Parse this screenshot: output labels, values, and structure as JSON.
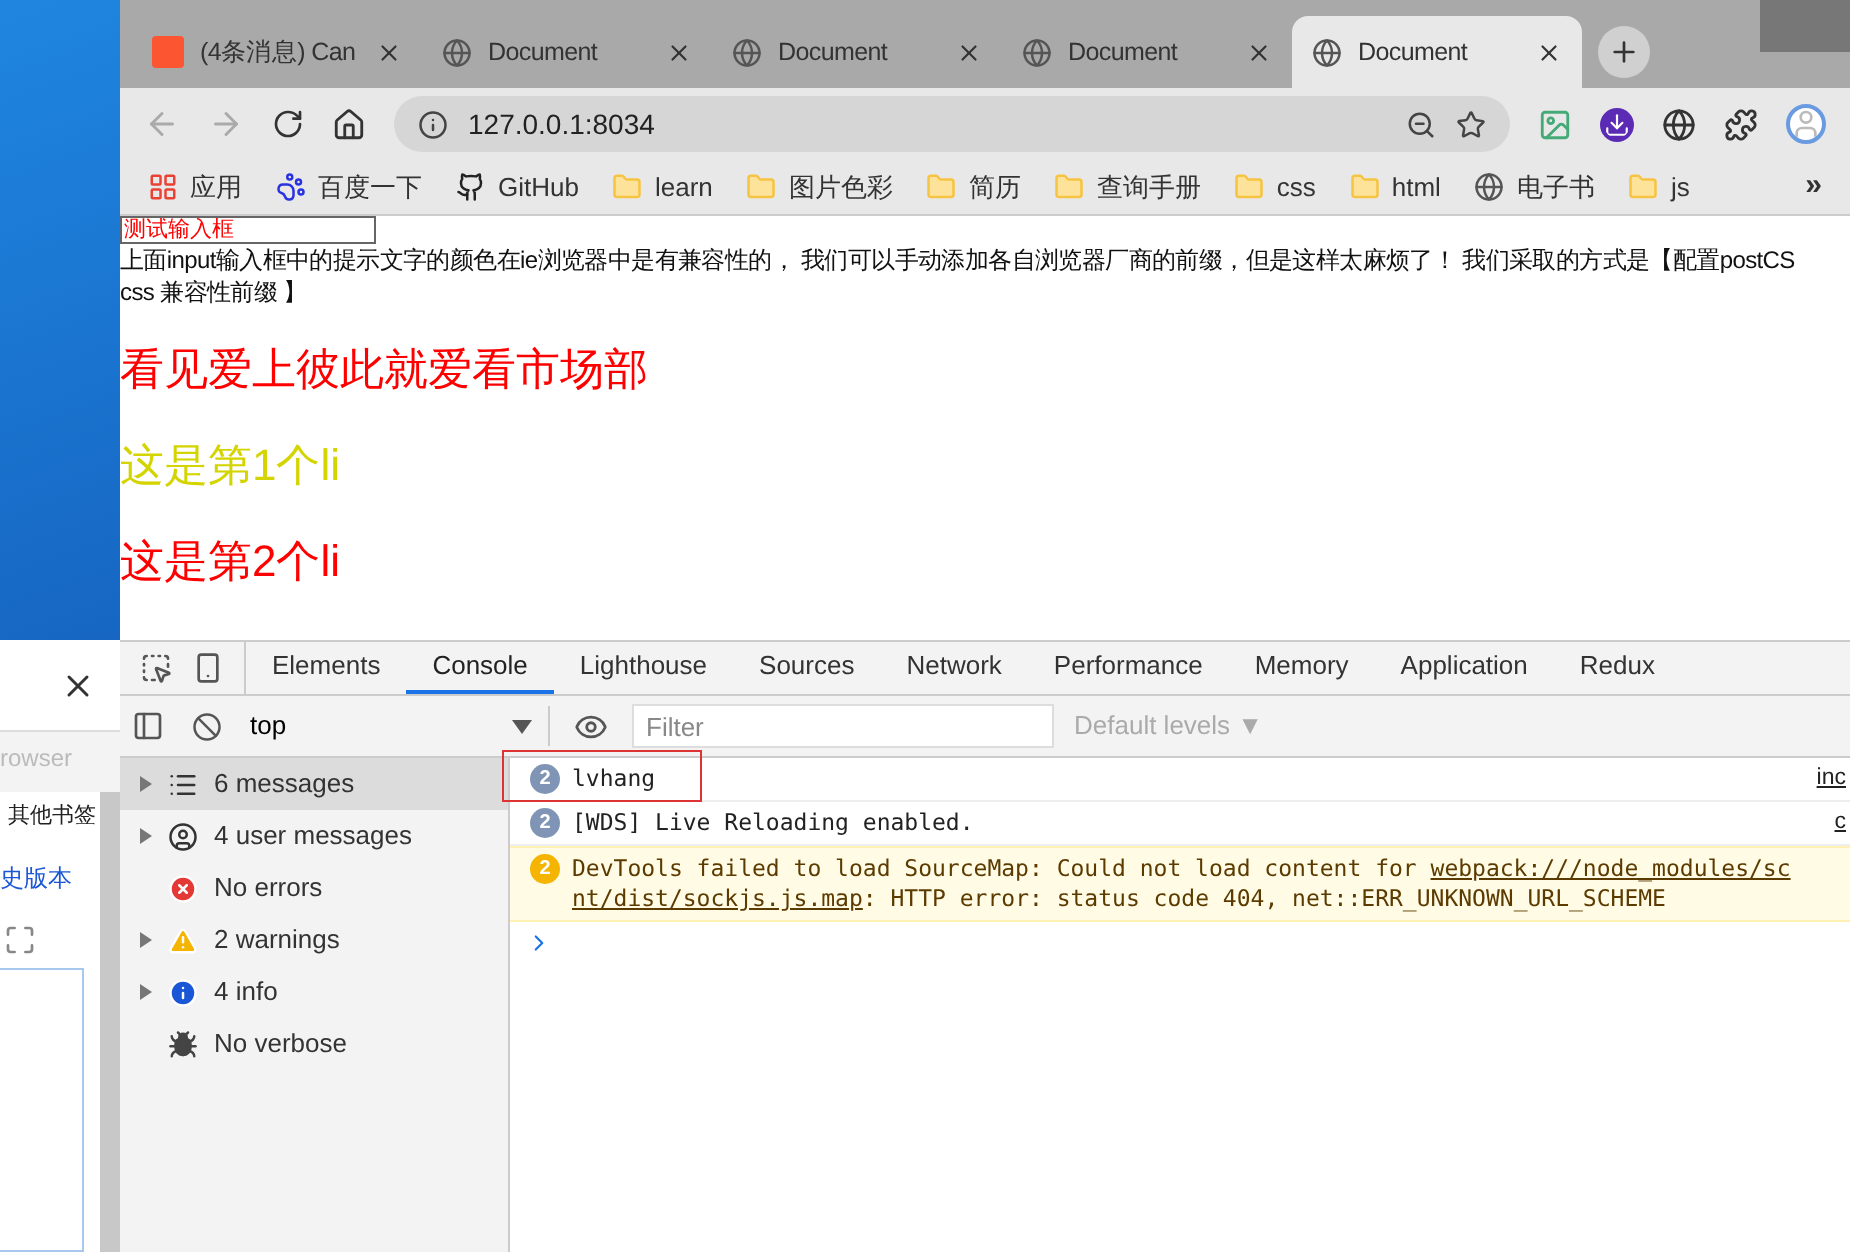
{
  "background_window": {
    "partial_label": "rowser",
    "bookmark": "其他书签",
    "link": "史版本"
  },
  "tabs": [
    {
      "title": "(4条消息) Can",
      "kind": "c",
      "selected": false
    },
    {
      "title": "Document",
      "kind": "globe",
      "selected": false
    },
    {
      "title": "Document",
      "kind": "globe",
      "selected": false
    },
    {
      "title": "Document",
      "kind": "globe",
      "selected": false
    },
    {
      "title": "Document",
      "kind": "globe",
      "selected": true
    }
  ],
  "address": "127.0.0.1:8034",
  "bookmarks": [
    {
      "label": "应用",
      "kind": "apps"
    },
    {
      "label": "百度一下",
      "kind": "baidu"
    },
    {
      "label": "GitHub",
      "kind": "github"
    },
    {
      "label": "learn",
      "kind": "folder"
    },
    {
      "label": "图片色彩",
      "kind": "folder"
    },
    {
      "label": "简历",
      "kind": "folder"
    },
    {
      "label": "查询手册",
      "kind": "folder"
    },
    {
      "label": "css",
      "kind": "folder"
    },
    {
      "label": "html",
      "kind": "folder"
    },
    {
      "label": "电子书",
      "kind": "globe"
    },
    {
      "label": "js",
      "kind": "folder"
    }
  ],
  "more_bookmarks": "»",
  "page": {
    "input_placeholder": "测试输入框",
    "paragraph": [
      "上面input输入框中的提示文字的颜色在ie浏览器中是有兼容性的， 我们可以手动添加各自浏览器厂商的前缀，但是这样太麻烦了！ 我们采取的方式是【配置postCS",
      "css 兼容性前缀 】"
    ],
    "headings": [
      {
        "text": "看见爱上彼此就爱看市场部",
        "color": "#ff0000"
      },
      {
        "text": "这是第1个li",
        "color": "#d4d400"
      },
      {
        "text": "这是第2个li",
        "color": "#ff0000"
      }
    ]
  },
  "devtools": {
    "tabs": [
      {
        "label": "Elements",
        "selected": false
      },
      {
        "label": "Console",
        "selected": true
      },
      {
        "label": "Lighthouse",
        "selected": false
      },
      {
        "label": "Sources",
        "selected": false
      },
      {
        "label": "Network",
        "selected": false
      },
      {
        "label": "Performance",
        "selected": false
      },
      {
        "label": "Memory",
        "selected": false
      },
      {
        "label": "Application",
        "selected": false
      },
      {
        "label": "Redux",
        "selected": false
      }
    ],
    "context": "top",
    "filter_placeholder": "Filter",
    "levels": "Default levels ▼",
    "sidebar": [
      {
        "label": "6 messages",
        "kind": "messages",
        "expandable": true,
        "selected": true
      },
      {
        "label": "4 user messages",
        "kind": "user",
        "expandable": true,
        "selected": false
      },
      {
        "label": "No errors",
        "kind": "error",
        "expandable": false,
        "selected": false
      },
      {
        "label": "2 warnings",
        "kind": "warning",
        "expandable": true,
        "selected": false
      },
      {
        "label": "4 info",
        "kind": "info",
        "expandable": true,
        "selected": false
      },
      {
        "label": "No verbose",
        "kind": "verbose",
        "expandable": false,
        "selected": false
      }
    ],
    "messages": [
      {
        "kind": "log",
        "count": "2",
        "text": "lvhang",
        "source": "inc",
        "highlighted": true
      },
      {
        "kind": "log",
        "count": "2",
        "text": "[WDS] Live Reloading enabled.",
        "source": "c"
      },
      {
        "kind": "warning",
        "count": "2",
        "text": "DevTools failed to load SourceMap: Could not load content for ",
        "link": "webpack:///node_modules/sc",
        "link_cont": "nt/dist/sockjs.js.map",
        "rest": ": HTTP error: status code 404, net::ERR_UNKNOWN_URL_SCHEME"
      }
    ]
  }
}
